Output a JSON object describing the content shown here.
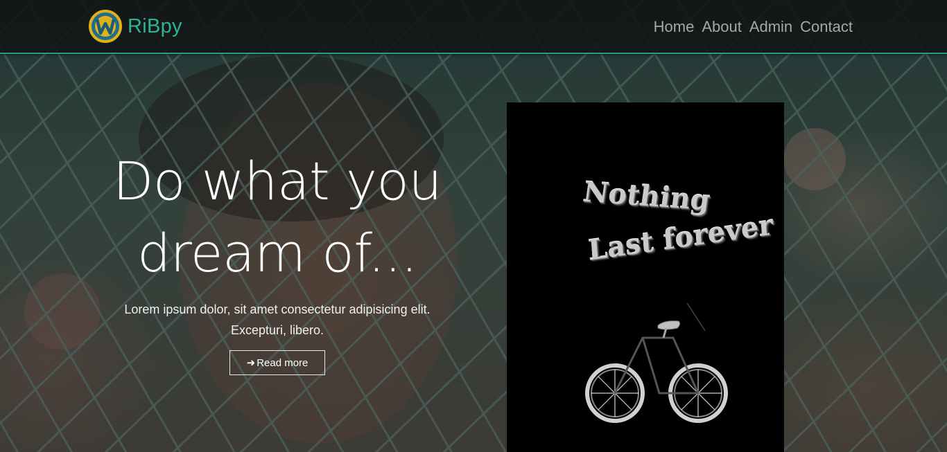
{
  "brand": {
    "name": "RiBpy",
    "logo_icon": "w-logo-icon"
  },
  "nav": {
    "links": [
      {
        "label": "Home"
      },
      {
        "label": "About"
      },
      {
        "label": "Admin"
      },
      {
        "label": "Contact"
      }
    ]
  },
  "hero": {
    "heading_line1": "Do what you",
    "heading_line2": "dream of...",
    "subtitle_line1": "Lorem ipsum dolor, sit amet consectetur adipisicing elit.",
    "subtitle_line2": "Excepturi, libero.",
    "button_label": "Read more",
    "button_icon": "arrow-right-icon"
  },
  "poster": {
    "line1": "Nothing",
    "line2": "Last forever",
    "image_icon": "bicycle-icon"
  },
  "colors": {
    "accent": "#2eb58f",
    "nav_border": "#2e9a83",
    "nav_text": "#a7a7a7",
    "navbar_bg": "#101414",
    "poster_bg": "#000000"
  }
}
